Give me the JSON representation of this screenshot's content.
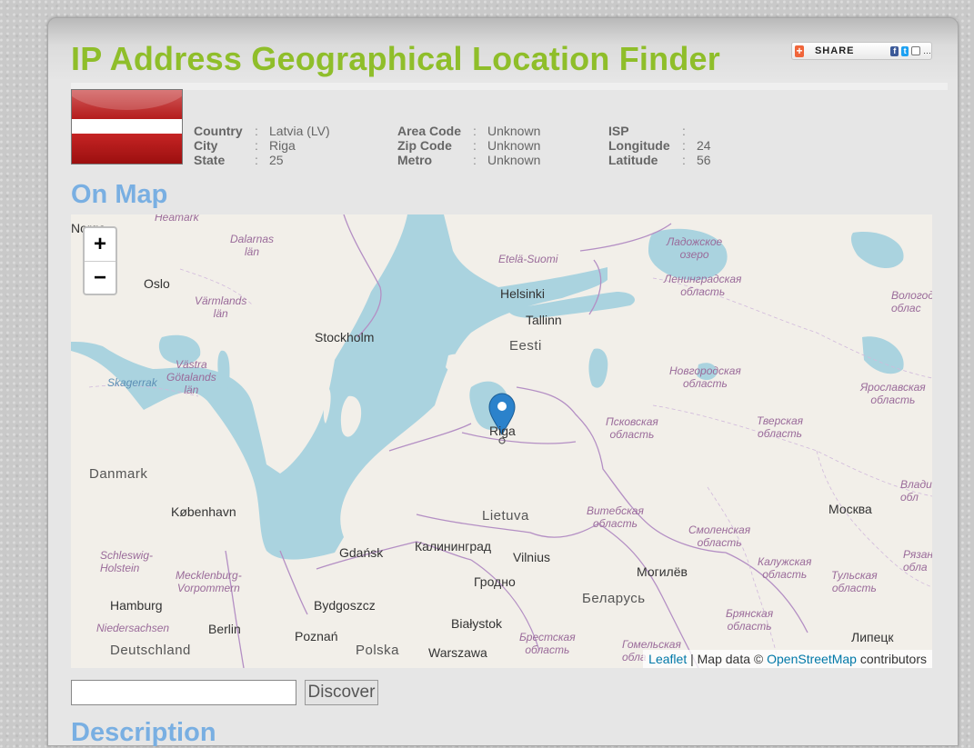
{
  "page": {
    "title": "IP Address Geographical Location Finder",
    "share_label": "SHARE",
    "share_icons": [
      "facebook-icon",
      "twitter-icon",
      "email-icon"
    ]
  },
  "flag": {
    "country": "Latvia",
    "colors": {
      "red": "#9e1b1b",
      "white": "#ffffff"
    }
  },
  "info": {
    "col1": [
      {
        "label": "Country",
        "value": "Latvia (LV)"
      },
      {
        "label": "City",
        "value": "Riga"
      },
      {
        "label": "State",
        "value": "25"
      }
    ],
    "col2": [
      {
        "label": "Area Code",
        "value": "Unknown"
      },
      {
        "label": "Zip Code",
        "value": "Unknown"
      },
      {
        "label": "Metro",
        "value": "Unknown"
      }
    ],
    "col3": [
      {
        "label": "ISP",
        "value": ""
      },
      {
        "label": "Longitude",
        "value": "24"
      },
      {
        "label": "Latitude",
        "value": "56"
      }
    ],
    "separator": ":"
  },
  "map": {
    "heading": "On Map",
    "zoom_in": "+",
    "zoom_out": "−",
    "attribution": {
      "leaflet": "Leaflet",
      "middle": " | Map data © ",
      "osm": "OpenStreetMap",
      "tail": " contributors"
    },
    "marker": "Riga",
    "labels": {
      "norge": "Norge",
      "heamark": "Heamark",
      "dalarnas": "Dalarnas\nlän",
      "oslo": "Oslo",
      "varmlands": "Värmlands\nlän",
      "stockholm": "Stockholm",
      "helsinki": "Helsinki",
      "etela": "Etelä-Suomi",
      "tallinn": "Tallinn",
      "eesti": "Eesti",
      "ladoga": "Ладожское\nозеро",
      "lenobl": "Ленинградская\nобласть",
      "vologod": "Вологод\nоблас",
      "vastra": "Västra\nGötalands\nlän",
      "skagerrak": "Skagerrak",
      "novgorod": "Новгородская\nобласть",
      "yaroslav": "Ярославская\nобласть",
      "riga": "Riga",
      "pskov": "Псковская\nобласть",
      "tver": "Тверская\nобласть",
      "danmark": "Danmark",
      "kobenhavn": "København",
      "lietuva": "Lietuva",
      "vitebsk": "Витебская\nобласть",
      "moskva": "Москва",
      "vladim": "Владим\nобл",
      "schleswig": "Schleswig-\nHolstein",
      "mecklenburg": "Mecklenburg-\nVorpommern",
      "gdansk": "Gdańsk",
      "kaliningrad": "Калининград",
      "vilnius": "Vilnius",
      "smolensk": "Смоленская\nобласть",
      "ryazan": "Рязан\nобла",
      "grodno": "Гродно",
      "mogilev": "Могилёв",
      "kaluga": "Калужская\nобласть",
      "tula": "Тульская\nобласть",
      "hamburg": "Hamburg",
      "bydgoszcz": "Bydgoszcz",
      "belarus": "Беларусь",
      "bryansk": "Брянская\nобласть",
      "niedersachsen": "Niedersachsen",
      "berlin": "Berlin",
      "poznan": "Poznań",
      "bialystok": "Białystok",
      "brest": "Брестская\nобласть",
      "lipetsk": "Липецк",
      "deutschland": "Deutschland",
      "polska": "Polska",
      "warszawa": "Warszawa",
      "gomel": "Гомельская\nобла"
    }
  },
  "search": {
    "value": "",
    "placeholder": "",
    "button_label": "Discover"
  },
  "next_section": {
    "heading": "Description"
  }
}
